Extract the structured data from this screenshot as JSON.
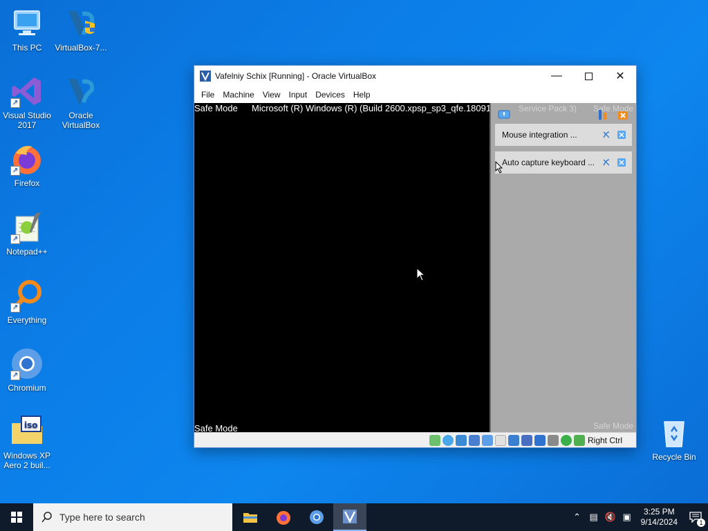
{
  "desktop": {
    "icons": [
      {
        "label": "This PC"
      },
      {
        "label": "VirtualBox-7..."
      },
      {
        "label": "Visual Studio 2017"
      },
      {
        "label": "Oracle VirtualBox"
      },
      {
        "label": "Firefox"
      },
      {
        "label": "Notepad++"
      },
      {
        "label": "Everything"
      },
      {
        "label": "Chromium"
      },
      {
        "label": "Windows XP Aero 2 buil..."
      },
      {
        "label": "Recycle Bin"
      }
    ]
  },
  "vbox": {
    "title": "Vafelniy  Schix [Running] - Oracle VirtualBox",
    "menu": [
      "File",
      "Machine",
      "View",
      "Input",
      "Devices",
      "Help"
    ],
    "vm_screen": {
      "top_left": "Safe Mode",
      "build_text": "Microsoft (R) Windows (R) (Build 2600.xpsp_sp3_qfe.180912",
      "behind_text": "Service Pack 3)",
      "top_right": "Safe Mode",
      "bottom_left": "Safe Mode",
      "bottom_right": "Safe Mode"
    },
    "notifications": [
      {
        "text": "Mouse integration ..."
      },
      {
        "text": "Auto capture keyboard ..."
      }
    ],
    "statusbar": {
      "host_key": "Right Ctrl"
    }
  },
  "taskbar": {
    "search_placeholder": "Type here to search",
    "clock_time": "3:25 PM",
    "clock_date": "9/14/2024",
    "notification_count": "1"
  },
  "colors": {
    "desktop": "#0c7ee8",
    "taskbar": "#0f1a2a",
    "panel": "#aaaaaa"
  }
}
